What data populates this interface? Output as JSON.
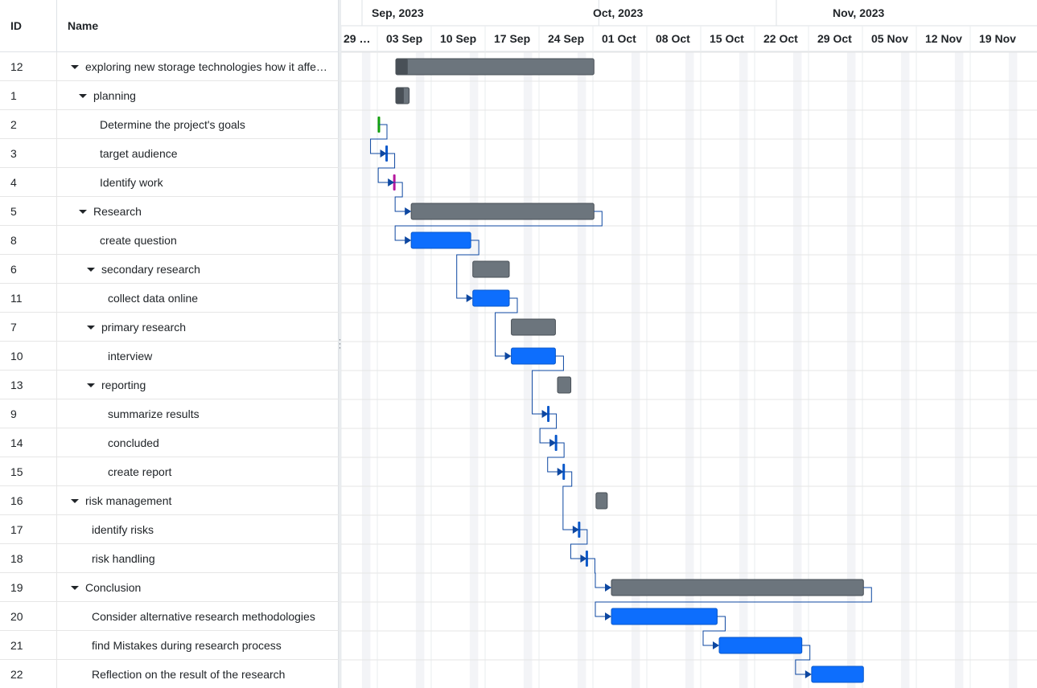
{
  "grid": {
    "header": {
      "id": "ID",
      "name": "Name"
    },
    "rows": [
      {
        "id": "12",
        "name": "exploring new storage technologies how it affe…",
        "level": 0,
        "parent": true
      },
      {
        "id": "1",
        "name": "planning",
        "level": 1,
        "parent": true
      },
      {
        "id": "2",
        "name": "Determine the project's goals",
        "level": 2,
        "parent": false
      },
      {
        "id": "3",
        "name": "target audience",
        "level": 2,
        "parent": false
      },
      {
        "id": "4",
        "name": "Identify work",
        "level": 2,
        "parent": false
      },
      {
        "id": "5",
        "name": "Research",
        "level": 1,
        "parent": true
      },
      {
        "id": "8",
        "name": "create question",
        "level": 2,
        "parent": false
      },
      {
        "id": "6",
        "name": "secondary research",
        "level": 2,
        "parent": true
      },
      {
        "id": "11",
        "name": "collect data online",
        "level": 3,
        "parent": false
      },
      {
        "id": "7",
        "name": "primary research",
        "level": 2,
        "parent": true
      },
      {
        "id": "10",
        "name": "interview",
        "level": 3,
        "parent": false
      },
      {
        "id": "13",
        "name": "reporting",
        "level": 2,
        "parent": true
      },
      {
        "id": "9",
        "name": "summarize results",
        "level": 3,
        "parent": false
      },
      {
        "id": "14",
        "name": "concluded",
        "level": 3,
        "parent": false
      },
      {
        "id": "15",
        "name": "create report",
        "level": 3,
        "parent": false
      },
      {
        "id": "16",
        "name": "risk management",
        "level": 0,
        "parent": true
      },
      {
        "id": "17",
        "name": "identify risks",
        "level": 1,
        "parent": false
      },
      {
        "id": "18",
        "name": "risk handling",
        "level": 1,
        "parent": false
      },
      {
        "id": "19",
        "name": "Conclusion",
        "level": 0,
        "parent": true
      },
      {
        "id": "20",
        "name": "Consider alternative research methodologies",
        "level": 1,
        "parent": false
      },
      {
        "id": "21",
        "name": "find Mistakes during research process",
        "level": 1,
        "parent": false
      },
      {
        "id": "22",
        "name": "Reflection on the result of the research",
        "level": 1,
        "parent": false
      }
    ]
  },
  "timeline": {
    "months": [
      "Sep, 2023",
      "Oct, 2023",
      "Nov, 2023"
    ],
    "weeks": [
      "29 …",
      "03 Sep",
      "10 Sep",
      "17 Sep",
      "24 Sep",
      "01 Oct",
      "08 Oct",
      "15 Oct",
      "22 Oct",
      "29 Oct",
      "05 Nov",
      "12 Nov",
      "19 Nov"
    ]
  },
  "colors": {
    "task": "#0d6efd",
    "summary": "#6c757d",
    "progress": "#495057",
    "connector": "#0d47a1",
    "milestone_default": "#0a58ca",
    "milestone_green": "#13a10e",
    "milestone_magenta": "#b5179e",
    "weekend": "#f3f4f7"
  },
  "tasks": [
    {
      "row": 0,
      "type": "summary",
      "start": "2023-09-03",
      "end": "2023-09-28",
      "progress": 0.06
    },
    {
      "row": 1,
      "type": "summary",
      "start": "2023-09-03",
      "end": "2023-09-04",
      "progress": 0.6
    },
    {
      "row": 2,
      "type": "milestone",
      "date": "2023-09-03",
      "color": "milestone_green"
    },
    {
      "row": 3,
      "type": "milestone",
      "date": "2023-09-04",
      "color": "milestone_default"
    },
    {
      "row": 4,
      "type": "milestone",
      "date": "2023-09-05",
      "color": "milestone_magenta"
    },
    {
      "row": 5,
      "type": "summary",
      "start": "2023-09-05",
      "end": "2023-09-28",
      "progress": 0
    },
    {
      "row": 6,
      "type": "task",
      "start": "2023-09-05",
      "end": "2023-09-12"
    },
    {
      "row": 7,
      "type": "summary",
      "start": "2023-09-13",
      "end": "2023-09-17",
      "progress": 0
    },
    {
      "row": 8,
      "type": "task",
      "start": "2023-09-13",
      "end": "2023-09-17"
    },
    {
      "row": 9,
      "type": "summary",
      "start": "2023-09-18",
      "end": "2023-09-23",
      "progress": 0
    },
    {
      "row": 10,
      "type": "task",
      "start": "2023-09-18",
      "end": "2023-09-23"
    },
    {
      "row": 11,
      "type": "summary",
      "start": "2023-09-24",
      "end": "2023-09-25",
      "progress": 0
    },
    {
      "row": 12,
      "type": "milestone",
      "date": "2023-09-25",
      "color": "milestone_default"
    },
    {
      "row": 13,
      "type": "milestone",
      "date": "2023-09-26",
      "color": "milestone_default"
    },
    {
      "row": 14,
      "type": "milestone",
      "date": "2023-09-27",
      "color": "milestone_default"
    },
    {
      "row": 15,
      "type": "summary",
      "start": "2023-09-29",
      "end": "2023-09-29",
      "progress": 0
    },
    {
      "row": 16,
      "type": "milestone",
      "date": "2023-09-29",
      "color": "milestone_default"
    },
    {
      "row": 17,
      "type": "milestone",
      "date": "2023-09-30",
      "color": "milestone_default"
    },
    {
      "row": 18,
      "type": "summary",
      "start": "2023-10-01",
      "end": "2023-11-02",
      "progress": 0
    },
    {
      "row": 19,
      "type": "task",
      "start": "2023-10-01",
      "end": "2023-10-14"
    },
    {
      "row": 20,
      "type": "task",
      "start": "2023-10-15",
      "end": "2023-10-25"
    },
    {
      "row": 21,
      "type": "task",
      "start": "2023-10-27",
      "end": "2023-11-02"
    }
  ],
  "links": [
    [
      2,
      3
    ],
    [
      3,
      4
    ],
    [
      4,
      5
    ],
    [
      5,
      6
    ],
    [
      6,
      8
    ],
    [
      8,
      10
    ],
    [
      10,
      12
    ],
    [
      12,
      13
    ],
    [
      13,
      14
    ],
    [
      14,
      16
    ],
    [
      16,
      17
    ],
    [
      17,
      18
    ],
    [
      18,
      19
    ],
    [
      19,
      20
    ],
    [
      20,
      21
    ]
  ]
}
